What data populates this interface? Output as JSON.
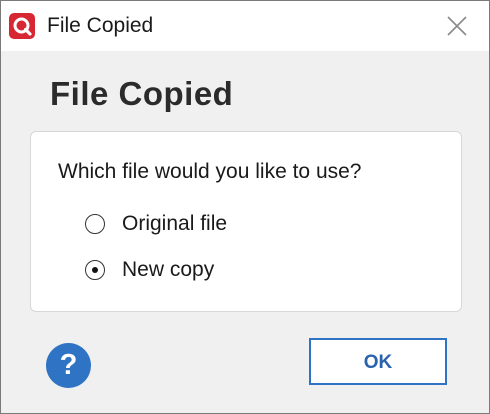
{
  "window": {
    "title": "File Copied",
    "app_icon": "app-logo-icon",
    "close_icon": "close-icon"
  },
  "dialog": {
    "heading": "File Copied",
    "question": "Which file would you like to use?",
    "options": [
      {
        "label": "Original file",
        "selected": false
      },
      {
        "label": "New copy",
        "selected": true
      }
    ]
  },
  "footer": {
    "help_label": "?",
    "ok_label": "OK"
  },
  "colors": {
    "accent": "#2f73c4",
    "app_icon": "#d62732",
    "background": "#f0f0f0"
  }
}
